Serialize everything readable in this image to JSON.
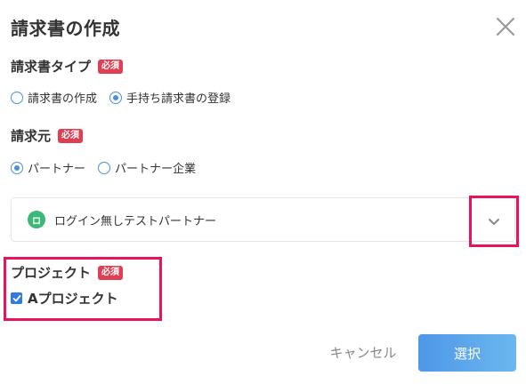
{
  "dialog": {
    "title": "請求書の作成"
  },
  "invoice_type": {
    "label": "請求書タイプ",
    "required_badge": "必須",
    "options": [
      {
        "label": "請求書の作成",
        "checked": false
      },
      {
        "label": "手持ち請求書の登録",
        "checked": true
      }
    ]
  },
  "billing_source": {
    "label": "請求元",
    "required_badge": "必須",
    "options": [
      {
        "label": "パートナー",
        "checked": true
      },
      {
        "label": "パートナー企業",
        "checked": false
      }
    ],
    "selected_partner": {
      "avatar_initial": "ロ",
      "name": "ログイン無しテストパートナー",
      "avatar_color": "#3cb878"
    }
  },
  "project": {
    "label": "プロジェクト",
    "required_badge": "必須",
    "items": [
      {
        "label": "Aプロジェクト",
        "checked": true
      }
    ]
  },
  "footer": {
    "cancel_label": "キャンセル",
    "select_label": "選択"
  },
  "colors": {
    "accent": "#4a90d9",
    "required_badge": "#e03e52",
    "highlight": "#e8135a"
  }
}
